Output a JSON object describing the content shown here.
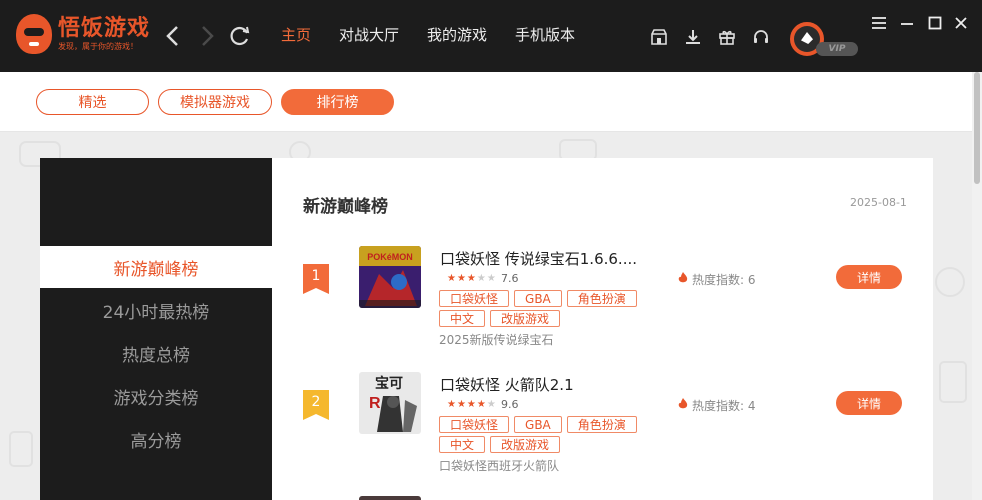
{
  "app": {
    "logo_title": "悟饭游戏",
    "logo_subtitle": "发现，属于你的游戏！"
  },
  "main_nav": [
    "主页",
    "对战大厅",
    "我的游戏",
    "手机版本"
  ],
  "user": {
    "vip_label": "VIP"
  },
  "sub_tabs": [
    "精选",
    "模拟器游戏",
    "排行榜"
  ],
  "sidebar": [
    "新游巅峰榜",
    "24小时最热榜",
    "热度总榜",
    "游戏分类榜",
    "高分榜"
  ],
  "panel": {
    "title": "新游巅峰榜",
    "date": "2025-08-1"
  },
  "games": [
    {
      "rank": "1",
      "name": "口袋妖怪 传说绿宝石1.6.6....",
      "stars": 3,
      "score": "7.6",
      "tags": [
        "口袋妖怪",
        "GBA",
        "角色扮演",
        "中文",
        "改版游戏"
      ],
      "desc": "2025新版传说绿宝石",
      "heat_label": "热度指数: 6",
      "button": "详情"
    },
    {
      "rank": "2",
      "name": "口袋妖怪 火箭队2.1",
      "stars": 4,
      "score": "9.6",
      "tags": [
        "口袋妖怪",
        "GBA",
        "角色扮演",
        "中文",
        "改版游戏"
      ],
      "desc": "口袋妖怪西班牙火箭队",
      "heat_label": "热度指数: 4",
      "button": "详情"
    }
  ],
  "colors": {
    "accent": "#f26b3a",
    "topbar": "#1c1c1c",
    "rank1": "#f26b3a",
    "rank2": "#f5b82e"
  },
  "icons": [
    "back-icon",
    "forward-icon",
    "refresh-icon",
    "store-icon",
    "download-icon",
    "gift-icon",
    "headset-icon",
    "menu-icon",
    "minimize-icon",
    "maximize-icon",
    "close-icon",
    "fire-icon"
  ]
}
